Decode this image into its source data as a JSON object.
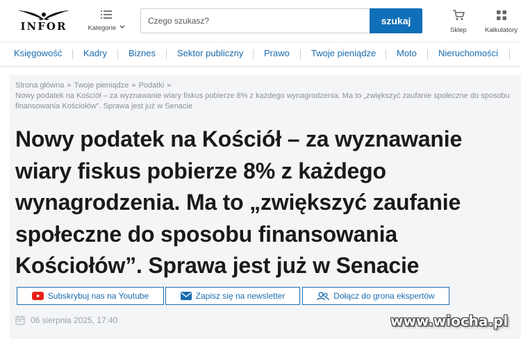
{
  "header": {
    "logo_text": "INFOR",
    "categories_label": "Kategorie",
    "search": {
      "placeholder": "Czego szukasz?",
      "value": ""
    },
    "search_button_label": "szukaj",
    "shop_label": "Sklep",
    "calculators_label": "Kalkulatory"
  },
  "nav": {
    "items": [
      {
        "label": "Księgowość"
      },
      {
        "label": "Kadry"
      },
      {
        "label": "Biznes"
      },
      {
        "label": "Sektor publiczny"
      },
      {
        "label": "Prawo"
      },
      {
        "label": "Twoje pieniądze"
      },
      {
        "label": "Moto"
      },
      {
        "label": "Nieruchomości"
      }
    ]
  },
  "breadcrumb": {
    "items": [
      "Strona główna",
      "Twoje pieniądze",
      "Podatki"
    ],
    "separator": "»",
    "current": "Nowy podatek na Kościół – za wyznawanie wiary fiskus pobierze 8% z każdego wynagrodzenia. Ma to „zwiększyć zaufanie społeczne do sposobu finansowania Kościołów”. Sprawa jest już w Senacie"
  },
  "article": {
    "title": "Nowy podatek na Kościół – za wyznawanie wiary fiskus pobierze 8% z każdego wynagrodzenia. Ma to „zwiększyć zaufanie społeczne do sposobu finansowania Kościołów”. Sprawa jest już w Senacie",
    "actions": {
      "youtube_label": "Subskrybuj nas na Youtube",
      "newsletter_label": "Zapisz się na newsletter",
      "experts_label": "Dołącz do grona ekspertów"
    },
    "date": "06 sierpnia 2025, 17:40"
  },
  "watermark": "www.wiocha.pl",
  "colors": {
    "accent": "#1b6cae",
    "search_button": "#0f6fb8",
    "youtube_red": "#e62117",
    "content_background": "#f4f5f7"
  },
  "icons": [
    "logo-eagle-icon",
    "menu-icon",
    "chevron-down-icon",
    "cart-icon",
    "grid-icon",
    "youtube-icon",
    "envelope-icon",
    "people-icon",
    "calendar-icon"
  ]
}
